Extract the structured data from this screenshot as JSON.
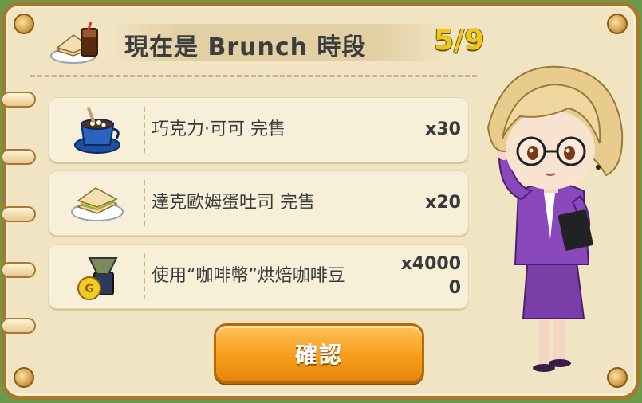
{
  "header": {
    "title": "現在是 Brunch 時段",
    "count": "5/9",
    "icon": "sandwich-and-iced-coffee-icon"
  },
  "items": [
    {
      "text": "巧克力·可可 完售",
      "quantity": "x30",
      "icon": "cocoa-cup-icon"
    },
    {
      "text": "達克歐姆蛋吐司 完售",
      "quantity": "x20",
      "icon": "sandwich-plate-icon"
    },
    {
      "text": "使用“咖啡幣”烘焙咖啡豆",
      "quantity": "x40000",
      "icon": "coffee-grinder-coin-icon"
    }
  ],
  "confirm_button": {
    "label": "確認"
  },
  "colors": {
    "panel": "#f1e4c2",
    "border": "#a9772f",
    "count": "#f0c61c",
    "button": "#f59a16"
  }
}
